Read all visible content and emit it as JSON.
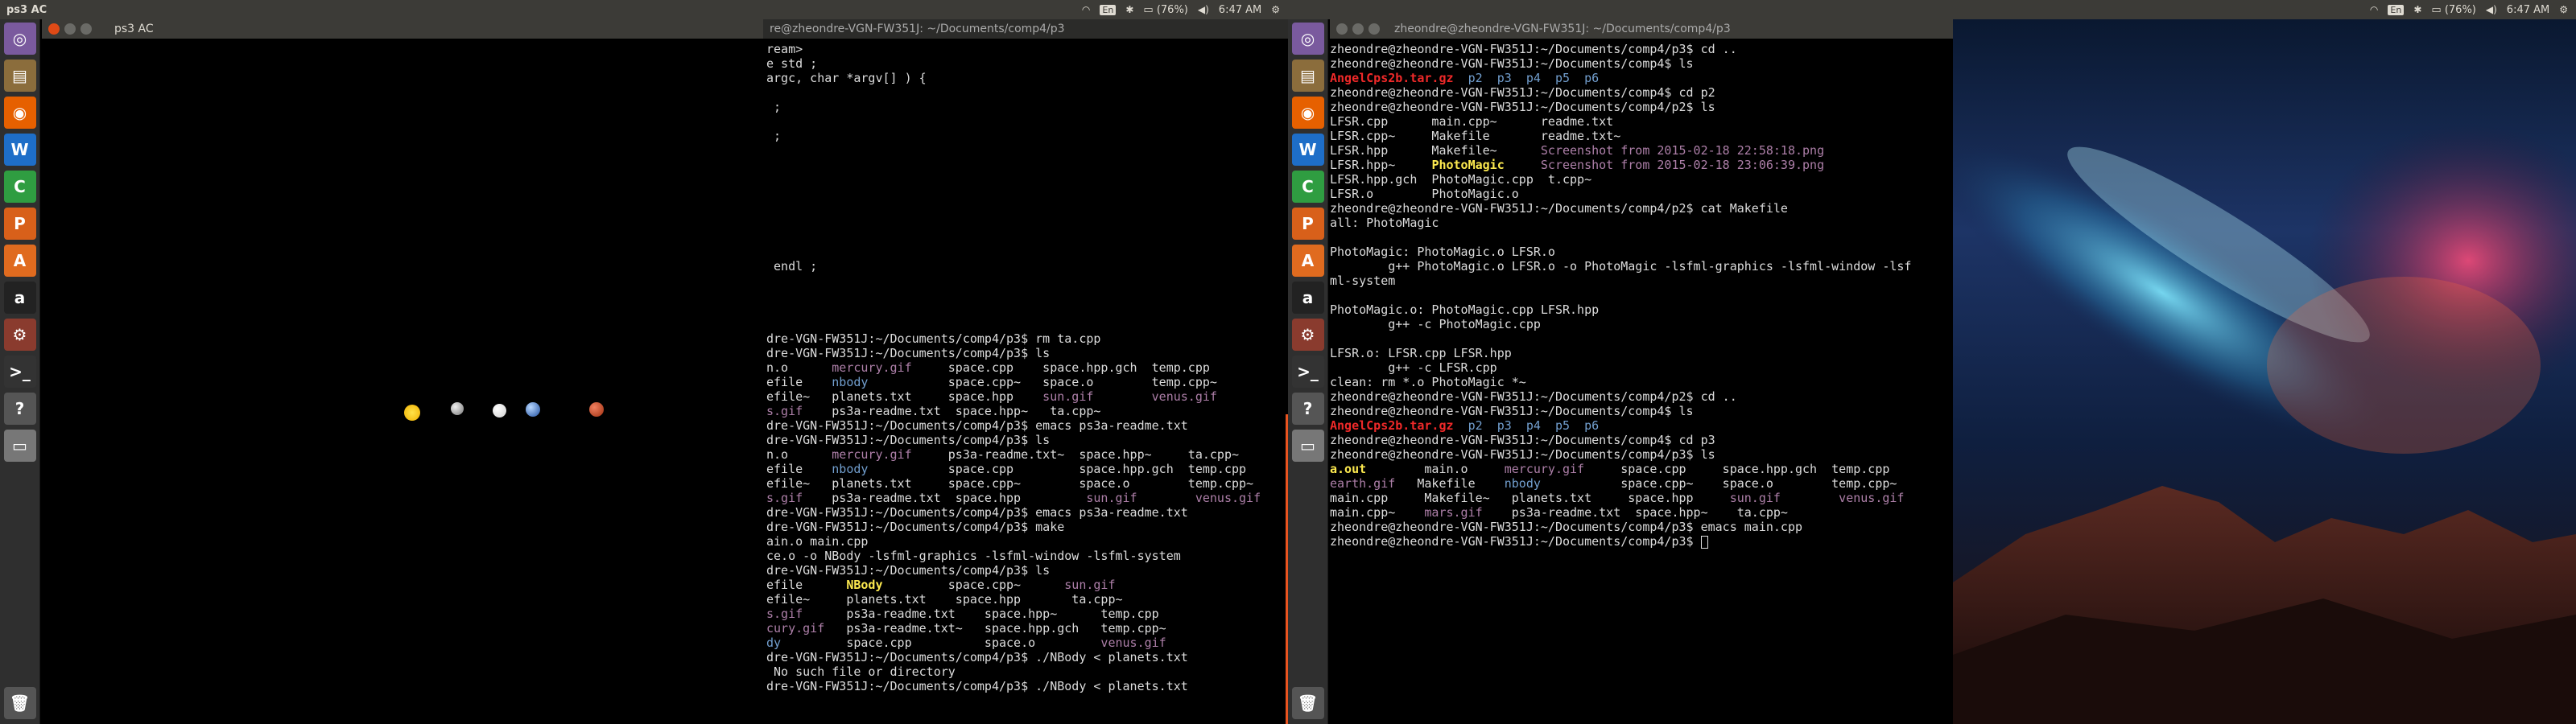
{
  "left_screen": {
    "panel_title": "ps3 AC",
    "window_title": "ps3 AC",
    "terminal_title": "re@zheondre-VGN-FW351J: ~/Documents/comp4/p3",
    "status": {
      "lang": "En",
      "battery": "(76%)",
      "time": "6:47 AM"
    },
    "terminal_lines": [
      {
        "segs": [
          {
            "t": "ream>"
          }
        ]
      },
      {
        "segs": [
          {
            "t": "e std ;"
          }
        ]
      },
      {
        "segs": [
          {
            "t": "argc, char *argv[] ) {"
          }
        ]
      },
      {
        "segs": [
          {
            "t": ""
          }
        ]
      },
      {
        "segs": [
          {
            "t": " ;"
          }
        ]
      },
      {
        "segs": [
          {
            "t": ""
          }
        ]
      },
      {
        "segs": [
          {
            "t": " ;"
          }
        ]
      },
      {
        "segs": [
          {
            "t": ""
          }
        ]
      },
      {
        "segs": [
          {
            "t": ""
          }
        ]
      },
      {
        "segs": [
          {
            "t": ""
          }
        ]
      },
      {
        "segs": [
          {
            "t": ""
          }
        ]
      },
      {
        "segs": [
          {
            "t": ""
          }
        ]
      },
      {
        "segs": [
          {
            "t": ""
          }
        ]
      },
      {
        "segs": [
          {
            "t": ""
          }
        ]
      },
      {
        "segs": [
          {
            "t": ""
          }
        ]
      },
      {
        "segs": [
          {
            "t": " endl ;"
          }
        ]
      },
      {
        "segs": [
          {
            "t": ""
          }
        ]
      },
      {
        "segs": [
          {
            "t": ""
          }
        ]
      },
      {
        "segs": [
          {
            "t": ""
          }
        ]
      },
      {
        "segs": [
          {
            "t": ""
          }
        ]
      },
      {
        "segs": [
          {
            "t": "dre-VGN-FW351J:~/Documents/comp4/p3$ rm ta.cpp"
          }
        ]
      },
      {
        "segs": [
          {
            "t": "dre-VGN-FW351J:~/Documents/comp4/p3$ ls"
          }
        ]
      },
      {
        "segs": [
          {
            "t": "n.o      "
          },
          {
            "t": "mercury.gif",
            "c": "mag"
          },
          {
            "t": "     space.cpp    space.hpp.gch  temp.cpp"
          }
        ]
      },
      {
        "segs": [
          {
            "t": "efile    "
          },
          {
            "t": "nbody",
            "c": "blue"
          },
          {
            "t": "           space.cpp~   space.o        temp.cpp~"
          }
        ]
      },
      {
        "segs": [
          {
            "t": "efile~   planets.txt     space.hpp    "
          },
          {
            "t": "sun.gif",
            "c": "mag"
          },
          {
            "t": "        "
          },
          {
            "t": "venus.gif",
            "c": "mag"
          }
        ]
      },
      {
        "segs": [
          {
            "t": "s.gif",
            "c": "mag"
          },
          {
            "t": "    ps3a-readme.txt  space.hpp~   ta.cpp~"
          }
        ]
      },
      {
        "segs": [
          {
            "t": "dre-VGN-FW351J:~/Documents/comp4/p3$ emacs ps3a-readme.txt"
          }
        ]
      },
      {
        "segs": [
          {
            "t": "dre-VGN-FW351J:~/Documents/comp4/p3$ ls"
          }
        ]
      },
      {
        "segs": [
          {
            "t": "n.o      "
          },
          {
            "t": "mercury.gif",
            "c": "mag"
          },
          {
            "t": "     ps3a-readme.txt~  space.hpp~     ta.cpp~"
          }
        ]
      },
      {
        "segs": [
          {
            "t": "efile    "
          },
          {
            "t": "nbody",
            "c": "blue"
          },
          {
            "t": "           space.cpp         space.hpp.gch  temp.cpp"
          }
        ]
      },
      {
        "segs": [
          {
            "t": "efile~   planets.txt     space.cpp~        space.o        temp.cpp~"
          }
        ]
      },
      {
        "segs": [
          {
            "t": "s.gif",
            "c": "mag"
          },
          {
            "t": "    ps3a-readme.txt  space.hpp         "
          },
          {
            "t": "sun.gif",
            "c": "mag"
          },
          {
            "t": "        "
          },
          {
            "t": "venus.gif",
            "c": "mag"
          }
        ]
      },
      {
        "segs": [
          {
            "t": "dre-VGN-FW351J:~/Documents/comp4/p3$ emacs ps3a-readme.txt"
          }
        ]
      },
      {
        "segs": [
          {
            "t": "dre-VGN-FW351J:~/Documents/comp4/p3$ make"
          }
        ]
      },
      {
        "segs": [
          {
            "t": "ain.o main.cpp"
          }
        ]
      },
      {
        "segs": [
          {
            "t": "ce.o -o NBody -lsfml-graphics -lsfml-window -lsfml-system"
          }
        ]
      },
      {
        "segs": [
          {
            "t": "dre-VGN-FW351J:~/Documents/comp4/p3$ ls"
          }
        ]
      },
      {
        "segs": [
          {
            "t": "efile      "
          },
          {
            "t": "NBody",
            "c": "yel"
          },
          {
            "t": "         space.cpp~      "
          },
          {
            "t": "sun.gif",
            "c": "mag"
          }
        ]
      },
      {
        "segs": [
          {
            "t": "efile~     planets.txt    space.hpp       ta.cpp~"
          }
        ]
      },
      {
        "segs": [
          {
            "t": "s.gif",
            "c": "mag"
          },
          {
            "t": "      ps3a-readme.txt    space.hpp~      temp.cpp"
          }
        ]
      },
      {
        "segs": [
          {
            "t": "cury.gif",
            "c": "mag"
          },
          {
            "t": "   ps3a-readme.txt~   space.hpp.gch   temp.cpp~"
          }
        ]
      },
      {
        "segs": [
          {
            "t": "dy",
            "c": "blue"
          },
          {
            "t": "         space.cpp          space.o         "
          },
          {
            "t": "venus.gif",
            "c": "mag"
          }
        ]
      },
      {
        "segs": [
          {
            "t": "dre-VGN-FW351J:~/Documents/comp4/p3$ ./NBody < planets.txt"
          }
        ]
      },
      {
        "segs": [
          {
            "t": " No such file or directory"
          }
        ]
      },
      {
        "segs": [
          {
            "t": "dre-VGN-FW351J:~/Documents/comp4/p3$ ./NBody < planets.txt"
          }
        ]
      }
    ]
  },
  "right_screen": {
    "terminal_title": "zheondre@zheondre-VGN-FW351J: ~/Documents/comp4/p3",
    "status": {
      "lang": "En",
      "battery": "(76%)",
      "time": "6:47 AM"
    },
    "terminal_lines": [
      {
        "segs": [
          {
            "t": "zheondre@zheondre-VGN-FW351J:~/Documents/comp4/p3$ cd .."
          }
        ]
      },
      {
        "segs": [
          {
            "t": "zheondre@zheondre-VGN-FW351J:~/Documents/comp4$ ls"
          }
        ]
      },
      {
        "segs": [
          {
            "t": "AngelCps2b.tar.gz",
            "c": "red"
          },
          {
            "t": "  "
          },
          {
            "t": "p2",
            "c": "blue"
          },
          {
            "t": "  "
          },
          {
            "t": "p3",
            "c": "blue"
          },
          {
            "t": "  "
          },
          {
            "t": "p4",
            "c": "blue"
          },
          {
            "t": "  "
          },
          {
            "t": "p5",
            "c": "blue"
          },
          {
            "t": "  "
          },
          {
            "t": "p6",
            "c": "blue"
          }
        ]
      },
      {
        "segs": [
          {
            "t": "zheondre@zheondre-VGN-FW351J:~/Documents/comp4$ cd p2"
          }
        ]
      },
      {
        "segs": [
          {
            "t": "zheondre@zheondre-VGN-FW351J:~/Documents/comp4/p2$ ls"
          }
        ]
      },
      {
        "segs": [
          {
            "t": "LFSR.cpp      main.cpp~      readme.txt"
          }
        ]
      },
      {
        "segs": [
          {
            "t": "LFSR.cpp~     Makefile       readme.txt~"
          }
        ]
      },
      {
        "segs": [
          {
            "t": "LFSR.hpp      Makefile~      "
          },
          {
            "t": "Screenshot from 2015-02-18 22:58:18.png",
            "c": "mag"
          }
        ]
      },
      {
        "segs": [
          {
            "t": "LFSR.hpp~     "
          },
          {
            "t": "PhotoMagic",
            "c": "yel"
          },
          {
            "t": "     "
          },
          {
            "t": "Screenshot from 2015-02-18 23:06:39.png",
            "c": "mag"
          }
        ]
      },
      {
        "segs": [
          {
            "t": "LFSR.hpp.gch  PhotoMagic.cpp  t.cpp~"
          }
        ]
      },
      {
        "segs": [
          {
            "t": "LFSR.o        PhotoMagic.o"
          }
        ]
      },
      {
        "segs": [
          {
            "t": "zheondre@zheondre-VGN-FW351J:~/Documents/comp4/p2$ cat Makefile"
          }
        ]
      },
      {
        "segs": [
          {
            "t": "all: PhotoMagic"
          }
        ]
      },
      {
        "segs": [
          {
            "t": ""
          }
        ]
      },
      {
        "segs": [
          {
            "t": "PhotoMagic: PhotoMagic.o LFSR.o"
          }
        ]
      },
      {
        "segs": [
          {
            "t": "        g++ PhotoMagic.o LFSR.o -o PhotoMagic -lsfml-graphics -lsfml-window -lsf"
          }
        ]
      },
      {
        "segs": [
          {
            "t": "ml-system"
          }
        ]
      },
      {
        "segs": [
          {
            "t": ""
          }
        ]
      },
      {
        "segs": [
          {
            "t": "PhotoMagic.o: PhotoMagic.cpp LFSR.hpp"
          }
        ]
      },
      {
        "segs": [
          {
            "t": "        g++ -c PhotoMagic.cpp"
          }
        ]
      },
      {
        "segs": [
          {
            "t": ""
          }
        ]
      },
      {
        "segs": [
          {
            "t": "LFSR.o: LFSR.cpp LFSR.hpp"
          }
        ]
      },
      {
        "segs": [
          {
            "t": "        g++ -c LFSR.cpp"
          }
        ]
      },
      {
        "segs": [
          {
            "t": "clean: rm *.o PhotoMagic *~"
          }
        ]
      },
      {
        "segs": [
          {
            "t": "zheondre@zheondre-VGN-FW351J:~/Documents/comp4/p2$ cd .."
          }
        ]
      },
      {
        "segs": [
          {
            "t": "zheondre@zheondre-VGN-FW351J:~/Documents/comp4$ ls"
          }
        ]
      },
      {
        "segs": [
          {
            "t": "AngelCps2b.tar.gz",
            "c": "red"
          },
          {
            "t": "  "
          },
          {
            "t": "p2",
            "c": "blue"
          },
          {
            "t": "  "
          },
          {
            "t": "p3",
            "c": "blue"
          },
          {
            "t": "  "
          },
          {
            "t": "p4",
            "c": "blue"
          },
          {
            "t": "  "
          },
          {
            "t": "p5",
            "c": "blue"
          },
          {
            "t": "  "
          },
          {
            "t": "p6",
            "c": "blue"
          }
        ]
      },
      {
        "segs": [
          {
            "t": "zheondre@zheondre-VGN-FW351J:~/Documents/comp4$ cd p3"
          }
        ]
      },
      {
        "segs": [
          {
            "t": "zheondre@zheondre-VGN-FW351J:~/Documents/comp4/p3$ ls"
          }
        ]
      },
      {
        "segs": [
          {
            "t": "a.out",
            "c": "yel"
          },
          {
            "t": "        main.o     "
          },
          {
            "t": "mercury.gif",
            "c": "mag"
          },
          {
            "t": "     space.cpp     space.hpp.gch  temp.cpp"
          }
        ]
      },
      {
        "segs": [
          {
            "t": "earth.gif",
            "c": "mag"
          },
          {
            "t": "   Makefile    "
          },
          {
            "t": "nbody",
            "c": "blue"
          },
          {
            "t": "           space.cpp~    space.o        temp.cpp~"
          }
        ]
      },
      {
        "segs": [
          {
            "t": "main.cpp     Makefile~   planets.txt     space.hpp     "
          },
          {
            "t": "sun.gif",
            "c": "mag"
          },
          {
            "t": "        "
          },
          {
            "t": "venus.gif",
            "c": "mag"
          }
        ]
      },
      {
        "segs": [
          {
            "t": "main.cpp~    "
          },
          {
            "t": "mars.gif",
            "c": "mag"
          },
          {
            "t": "    ps3a-readme.txt  space.hpp~    ta.cpp~"
          }
        ]
      },
      {
        "segs": [
          {
            "t": "zheondre@zheondre-VGN-FW351J:~/Documents/comp4/p3$ emacs main.cpp"
          }
        ]
      },
      {
        "segs": [
          {
            "t": "zheondre@zheondre-VGN-FW351J:~/Documents/comp4/p3$ "
          }
        ]
      }
    ]
  },
  "launcher_items": [
    {
      "name": "ubuntu-dash-icon",
      "glyph": "◎",
      "color": "#7a5a9e"
    },
    {
      "name": "files-icon",
      "glyph": "▤",
      "color": "#8b6d3c"
    },
    {
      "name": "firefox-icon",
      "glyph": "◉",
      "color": "#e66000"
    },
    {
      "name": "writer-icon",
      "glyph": "W",
      "color": "#1e6ec8"
    },
    {
      "name": "calc-icon",
      "glyph": "C",
      "color": "#2f9d41"
    },
    {
      "name": "impress-icon",
      "glyph": "P",
      "color": "#d8601a"
    },
    {
      "name": "software-center-icon",
      "glyph": "A",
      "color": "#e06b1f"
    },
    {
      "name": "amazon-icon",
      "glyph": "a",
      "color": "#222222"
    },
    {
      "name": "settings-icon",
      "glyph": "⚙",
      "color": "#8a3b2e"
    },
    {
      "name": "terminal-icon",
      "glyph": ">_",
      "color": "#333333"
    },
    {
      "name": "unknown-app-icon",
      "glyph": "?",
      "color": "#555555"
    },
    {
      "name": "drive-icon",
      "glyph": "▭",
      "color": "#777777"
    }
  ]
}
